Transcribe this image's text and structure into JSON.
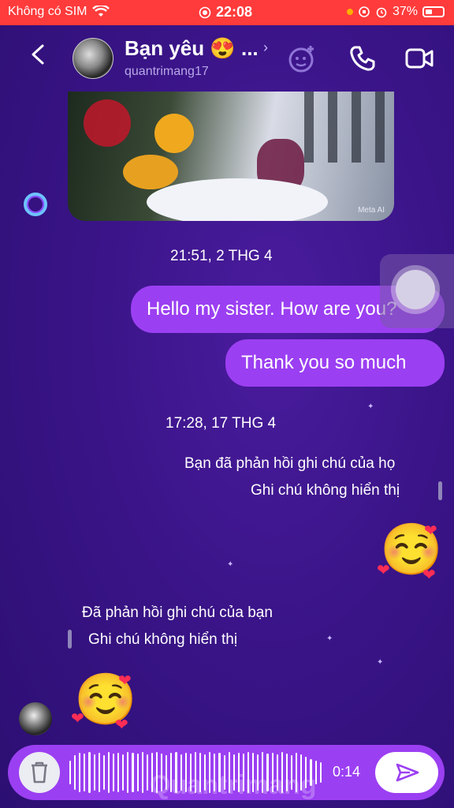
{
  "status_bar": {
    "carrier": "Không có SIM",
    "time": "22:08",
    "battery": "37%"
  },
  "header": {
    "contact_name": "Bạn yêu 😍 ...",
    "username": "quantrimang17"
  },
  "image_message": {
    "watermark": "Meta AI"
  },
  "messages": {
    "timestamp_1": "21:51, 2 THG 4",
    "sent_1": "Hello my sister. How are you?",
    "sent_2": "Thank you so much",
    "timestamp_2": "17:28, 17 THG 4",
    "note_sent_line1": "Bạn đã phản hồi ghi chú của họ",
    "note_sent_line2": "Ghi chú không hiển thị",
    "emoji_sent": "☺️",
    "note_received_line1": "Đã phản hồi ghi chú của bạn",
    "note_received_line2": "Ghi chú không hiển thị",
    "emoji_received": "☺️"
  },
  "composer": {
    "duration": "0:14"
  },
  "watermark_text": "Quantrimang",
  "colors": {
    "status_bar": "#ff3b3b",
    "bubble": "#9b3ff2",
    "background": "#3a1488"
  }
}
